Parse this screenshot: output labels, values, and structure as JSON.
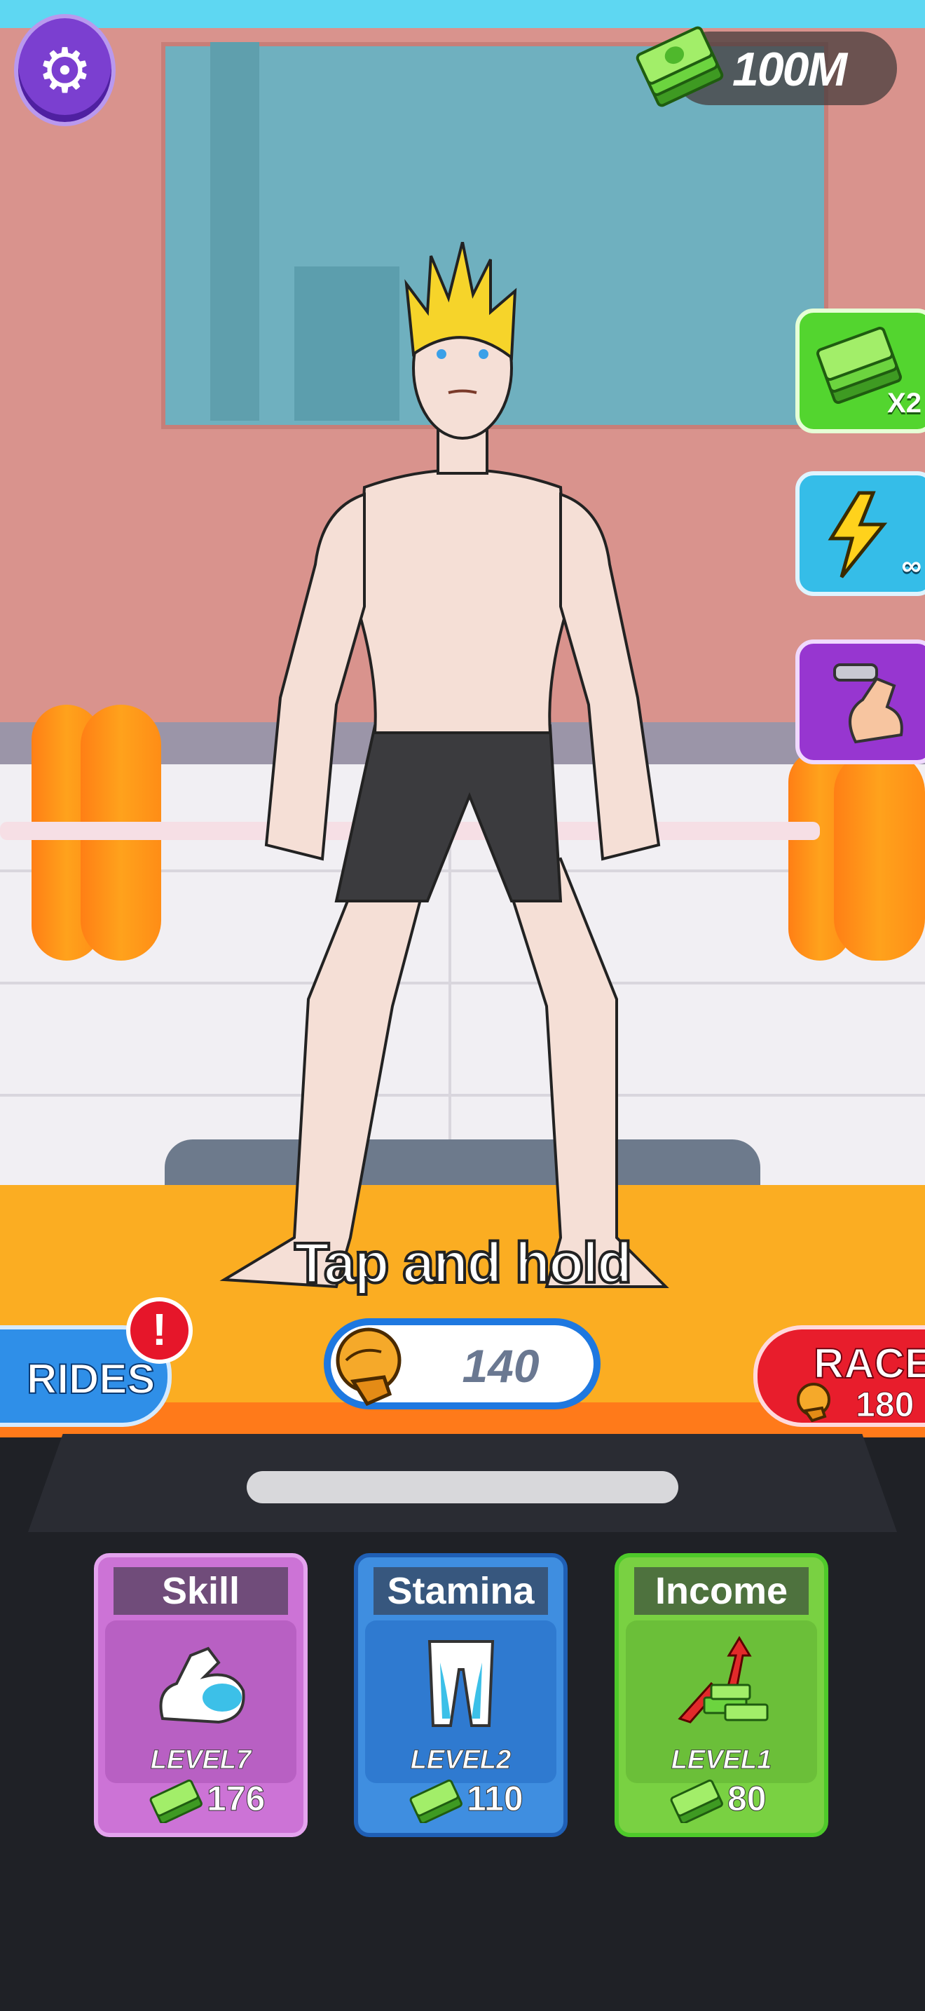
{
  "hud": {
    "money": "100M",
    "money_icon": "cash-stack-icon",
    "settings_icon": "gear-icon"
  },
  "side_boosts": [
    {
      "name": "cash-x2",
      "label": "X2",
      "icon": "cash-stack-icon"
    },
    {
      "name": "infinite-energy",
      "label": "∞",
      "icon": "lightning-icon"
    },
    {
      "name": "auto-lift",
      "label": "",
      "icon": "flexing-arm-dumbbell-icon"
    }
  ],
  "instruction": "Tap and hold",
  "strength_counter": {
    "value": "140",
    "icon": "boxing-glove-icon"
  },
  "rides": {
    "label": "RIDES",
    "alert": "!"
  },
  "race": {
    "label": "RACE",
    "value": "180",
    "icon": "boxing-glove-icon"
  },
  "upgrades": [
    {
      "title": "Skill",
      "level": "LEVEL7",
      "cost": "176",
      "icon": "flexed-bicep-icon"
    },
    {
      "title": "Stamina",
      "level": "LEVEL2",
      "cost": "110",
      "icon": "legs-icon"
    },
    {
      "title": "Income",
      "level": "LEVEL1",
      "cost": "80",
      "icon": "money-growth-icon"
    }
  ],
  "colors": {
    "settings": "#7b3fd0",
    "skill_card": "#cc73d6",
    "stamina_card": "#3f8ee0",
    "income_card": "#79d142",
    "race": "#e81d2c",
    "rides": "#2f8fe8",
    "mat": "#fbad22"
  }
}
